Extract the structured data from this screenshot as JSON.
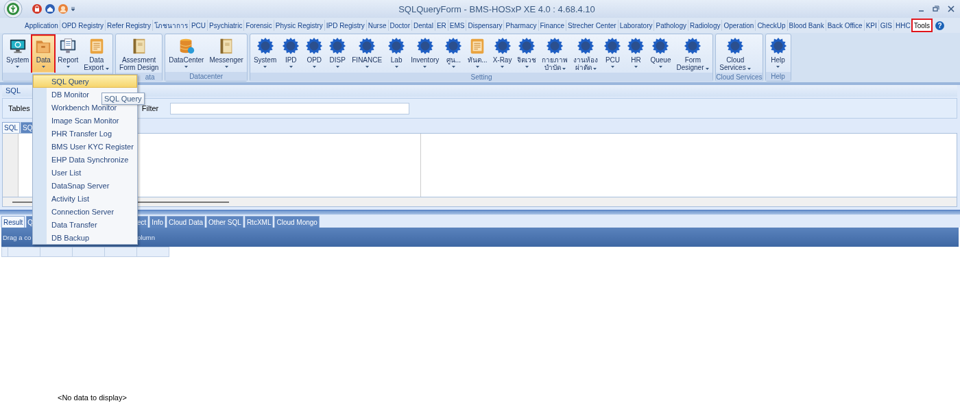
{
  "window": {
    "title": "SQLQueryForm - BMS-HOSxP XE 4.0 : 4.68.4.10"
  },
  "menu_tabs": [
    {
      "label": "Application",
      "selected": false
    },
    {
      "label": "OPD Registry",
      "selected": false
    },
    {
      "label": "Refer Registry",
      "selected": false
    },
    {
      "label": "โภชนาการ",
      "selected": false
    },
    {
      "label": "PCU",
      "selected": false
    },
    {
      "label": "Psychiatric",
      "selected": false
    },
    {
      "label": "Forensic",
      "selected": false
    },
    {
      "label": "Physic Registry",
      "selected": false
    },
    {
      "label": "IPD Registry",
      "selected": false
    },
    {
      "label": "Nurse",
      "selected": false
    },
    {
      "label": "Doctor",
      "selected": false
    },
    {
      "label": "Dental",
      "selected": false
    },
    {
      "label": "ER",
      "selected": false
    },
    {
      "label": "EMS",
      "selected": false
    },
    {
      "label": "Dispensary",
      "selected": false
    },
    {
      "label": "Pharmacy",
      "selected": false
    },
    {
      "label": "Finance",
      "selected": false
    },
    {
      "label": "Strecher Center",
      "selected": false
    },
    {
      "label": "Laboratory",
      "selected": false
    },
    {
      "label": "Pathology",
      "selected": false
    },
    {
      "label": "Radiology",
      "selected": false
    },
    {
      "label": "Operation",
      "selected": false
    },
    {
      "label": "CheckUp",
      "selected": false
    },
    {
      "label": "Blood Bank",
      "selected": false
    },
    {
      "label": "Back Office",
      "selected": false
    },
    {
      "label": "KPI",
      "selected": false
    },
    {
      "label": "GIS",
      "selected": false
    },
    {
      "label": "HHC",
      "selected": false
    },
    {
      "label": "Tools",
      "selected": true
    }
  ],
  "help_button": "?",
  "ribbon": {
    "groups": [
      {
        "buttons": [
          {
            "lines": [
              "System"
            ],
            "kind": "monitor",
            "dropdown": true,
            "selected": false
          },
          {
            "lines": [
              "Data"
            ],
            "kind": "folder",
            "dropdown": true,
            "selected": true
          },
          {
            "lines": [
              "Report"
            ],
            "kind": "report",
            "dropdown": true,
            "selected": false
          },
          {
            "lines": [
              "Data",
              "Export"
            ],
            "kind": "export",
            "dropdown": true,
            "selected": false
          }
        ]
      },
      {
        "label": "ata",
        "buttons": [
          {
            "lines": [
              "Assesment",
              "Form Design"
            ],
            "kind": "binder",
            "dropdown": false,
            "selected": false
          }
        ]
      },
      {
        "label": "Datacenter",
        "buttons": [
          {
            "lines": [
              "DataCenter"
            ],
            "kind": "database",
            "dropdown": true,
            "selected": false
          },
          {
            "lines": [
              "Messenger"
            ],
            "kind": "binder",
            "dropdown": true,
            "selected": false
          }
        ]
      },
      {
        "label": "Setting",
        "buttons": [
          {
            "lines": [
              "System"
            ],
            "kind": "gear",
            "dropdown": true,
            "selected": false
          },
          {
            "lines": [
              "IPD"
            ],
            "kind": "gear",
            "dropdown": true,
            "selected": false
          },
          {
            "lines": [
              "OPD"
            ],
            "kind": "gear",
            "dropdown": true,
            "selected": false
          },
          {
            "lines": [
              "DISP"
            ],
            "kind": "gear",
            "dropdown": true,
            "selected": false
          },
          {
            "lines": [
              "FINANCE"
            ],
            "kind": "gear",
            "dropdown": true,
            "selected": false
          },
          {
            "lines": [
              "Lab"
            ],
            "kind": "gear",
            "dropdown": true,
            "selected": false
          },
          {
            "lines": [
              "Inventory"
            ],
            "kind": "gear",
            "dropdown": true,
            "selected": false
          },
          {
            "lines": [
              "ศูน..."
            ],
            "kind": "gear",
            "dropdown": true,
            "selected": false
          },
          {
            "lines": [
              "ทันต..."
            ],
            "kind": "export",
            "dropdown": true,
            "selected": false
          },
          {
            "lines": [
              "X-Ray"
            ],
            "kind": "gear",
            "dropdown": true,
            "selected": false
          },
          {
            "lines": [
              "จิตเวช"
            ],
            "kind": "gear",
            "dropdown": true,
            "selected": false
          },
          {
            "lines": [
              "กายภาพ",
              "บำบัด"
            ],
            "kind": "gear",
            "dropdown": true,
            "selected": false
          },
          {
            "lines": [
              "งานห้อง",
              "ผ่าตัด"
            ],
            "kind": "gear",
            "dropdown": true,
            "selected": false
          },
          {
            "lines": [
              "PCU"
            ],
            "kind": "gear",
            "dropdown": true,
            "selected": false
          },
          {
            "lines": [
              "HR"
            ],
            "kind": "gear",
            "dropdown": true,
            "selected": false
          },
          {
            "lines": [
              "Queue"
            ],
            "kind": "gear",
            "dropdown": true,
            "selected": false
          },
          {
            "lines": [
              "Form",
              "Designer"
            ],
            "kind": "gear",
            "dropdown": true,
            "selected": false
          }
        ]
      },
      {
        "label": "Cloud Services",
        "buttons": [
          {
            "lines": [
              "Cloud",
              "Services"
            ],
            "kind": "gear",
            "dropdown": true,
            "selected": false
          }
        ]
      },
      {
        "label": "Help",
        "buttons": [
          {
            "lines": [
              "Help"
            ],
            "kind": "gear",
            "dropdown": true,
            "selected": false
          }
        ]
      }
    ]
  },
  "sql_panel": {
    "title": "SQL",
    "tables_label": "Tables",
    "filter_label": "Filter",
    "editor_tabs": [
      {
        "label": "SQL",
        "selected": true
      },
      {
        "label": "SQ",
        "selected": false
      }
    ]
  },
  "results": {
    "tabs": [
      {
        "label": "Result",
        "selected": true
      },
      {
        "label": "Q",
        "selected": false
      },
      {
        "label": "ect",
        "selected": false
      },
      {
        "label": "Info",
        "selected": false
      },
      {
        "label": "Cloud Data",
        "selected": false
      },
      {
        "label": "Other SQL",
        "selected": false
      },
      {
        "label": "RtcXML",
        "selected": false
      },
      {
        "label": "Cloud Mongo",
        "selected": false
      }
    ],
    "group_panel_texts": [
      "Drag a co",
      "olumn"
    ],
    "empty_text": "<No data to display>"
  },
  "dropdown_menu": {
    "items": [
      {
        "label": "SQL Query",
        "selected": true
      },
      {
        "label": "DB Monitor",
        "selected": false
      },
      {
        "label": "Workbench Monitor",
        "selected": false
      },
      {
        "label": "Image Scan Monitor",
        "selected": false
      },
      {
        "label": "PHR Transfer Log",
        "selected": false
      },
      {
        "label": "BMS User KYC Register",
        "selected": false
      },
      {
        "label": "EHP Data Synchronize",
        "selected": false
      },
      {
        "label": "User List",
        "selected": false
      },
      {
        "label": "DataSnap Server",
        "selected": false
      },
      {
        "label": "Activity List",
        "selected": false
      },
      {
        "label": "Connection Server",
        "selected": false
      },
      {
        "label": "Data Transfer",
        "selected": false
      },
      {
        "label": "DB Backup",
        "selected": false
      }
    ],
    "tooltip": "SQL Query"
  }
}
